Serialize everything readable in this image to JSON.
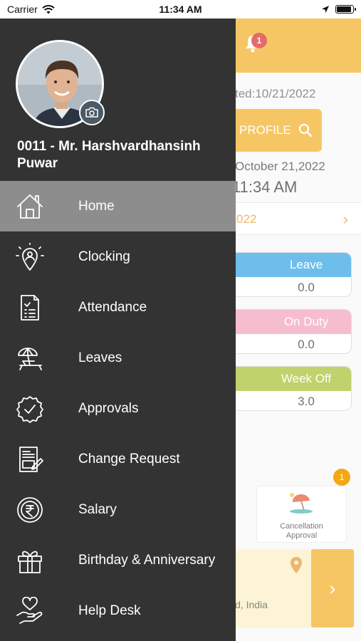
{
  "status_bar": {
    "carrier": "Carrier",
    "time": "11:34 AM",
    "battery_level": 0.9
  },
  "background": {
    "notification_count": "1",
    "updated_text": "ted:10/21/2022",
    "profile_button": "PROFILE",
    "date_text": "October 21,2022",
    "time_text": "11:34 AM",
    "month_text": "022",
    "cards": [
      {
        "label": "Leave",
        "value": "0.0",
        "color": "#1f9be0"
      },
      {
        "label": "On Duty",
        "value": "0.0",
        "color": "#f29ab6"
      },
      {
        "label": "Week Off",
        "value": "3.0",
        "color": "#9fba1c"
      }
    ],
    "cancellation_tile": {
      "label_line1": "Cancellation",
      "label_line2": "Approval",
      "badge": "1"
    },
    "location_text": "d, India"
  },
  "drawer": {
    "user_name": "0011 - Mr. Harshvardhansinh Puwar",
    "menu": [
      {
        "label": "Home",
        "icon": "home-icon",
        "active": true
      },
      {
        "label": "Clocking",
        "icon": "clocking-icon",
        "active": false
      },
      {
        "label": "Attendance",
        "icon": "attendance-icon",
        "active": false
      },
      {
        "label": "Leaves",
        "icon": "leaves-icon",
        "active": false
      },
      {
        "label": "Approvals",
        "icon": "approvals-icon",
        "active": false
      },
      {
        "label": "Change Request",
        "icon": "change-request-icon",
        "active": false
      },
      {
        "label": "Salary",
        "icon": "salary-icon",
        "active": false
      },
      {
        "label": "Birthday & Anniversary",
        "icon": "gift-icon",
        "active": false
      },
      {
        "label": "Help Desk",
        "icon": "help-desk-icon",
        "active": false
      }
    ]
  },
  "colors": {
    "drawer_bg": "#333333",
    "active_item_bg": "#8d8d8d",
    "accent": "#f3a812"
  }
}
